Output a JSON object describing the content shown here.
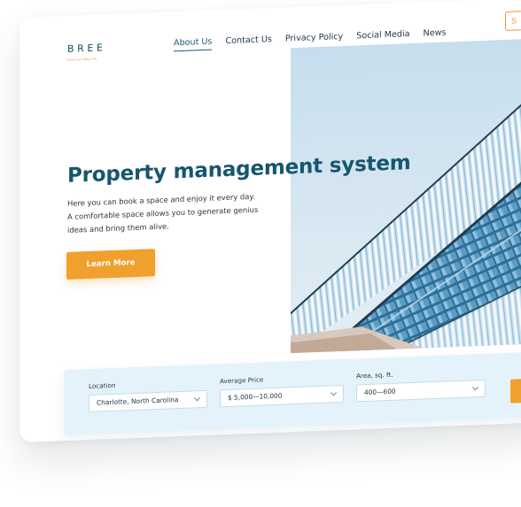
{
  "logo": {
    "name": "BREE",
    "tagline": "Find Your Way Life"
  },
  "nav": {
    "items": [
      {
        "label": "About Us",
        "active": true
      },
      {
        "label": "Contact Us"
      },
      {
        "label": "Privacy Policy"
      },
      {
        "label": "Social Media"
      },
      {
        "label": "News"
      }
    ],
    "corner_cta": "S"
  },
  "hero": {
    "title": "Property management system",
    "description": [
      "Here you can book a space and enjoy it every day.",
      "A comfortable space allows you to generate genius",
      "ideas and bring them alive."
    ],
    "button": "Learn More"
  },
  "search": {
    "location": {
      "label": "Location",
      "value": "Charlotte, North Carolina"
    },
    "price": {
      "label": "Average Price",
      "value": "$ 5,000—10,000"
    },
    "area": {
      "label": "Area, sq. ft.",
      "value": "400—600"
    }
  },
  "colors": {
    "brand": "#16566e",
    "accent": "#f0a02c",
    "search_bg": "#e4f3fb"
  }
}
